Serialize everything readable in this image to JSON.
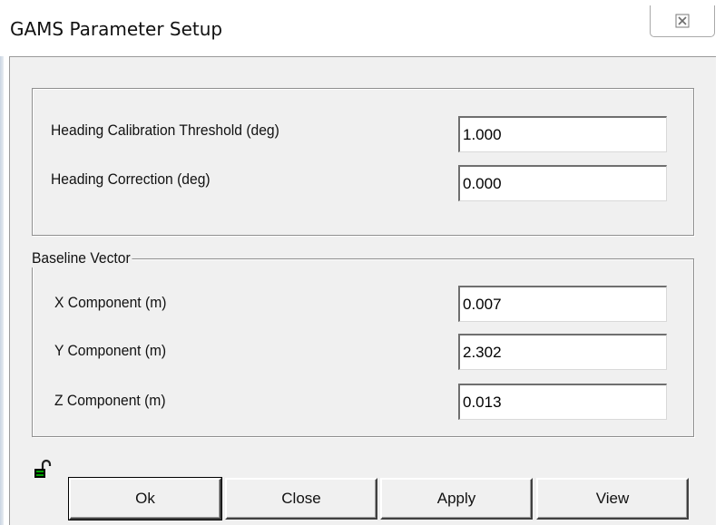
{
  "window": {
    "title": "GAMS Parameter Setup",
    "close_glyph": "☒"
  },
  "heading": {
    "threshold_label": "Heading Calibration Threshold (deg)",
    "threshold_value": "1.000",
    "correction_label": "Heading Correction (deg)",
    "correction_value": "0.000"
  },
  "baseline": {
    "group_label": "Baseline Vector",
    "x_label": "X Component (m)",
    "x_value": "0.007",
    "y_label": "Y Component (m)",
    "y_value": "2.302",
    "z_label": "Z Component (m)",
    "z_value": "0.013"
  },
  "buttons": {
    "ok": "Ok",
    "close": "Close",
    "apply": "Apply",
    "view": "View"
  },
  "icons": {
    "lock": "unlocked-padlock-icon",
    "close": "close-icon"
  }
}
